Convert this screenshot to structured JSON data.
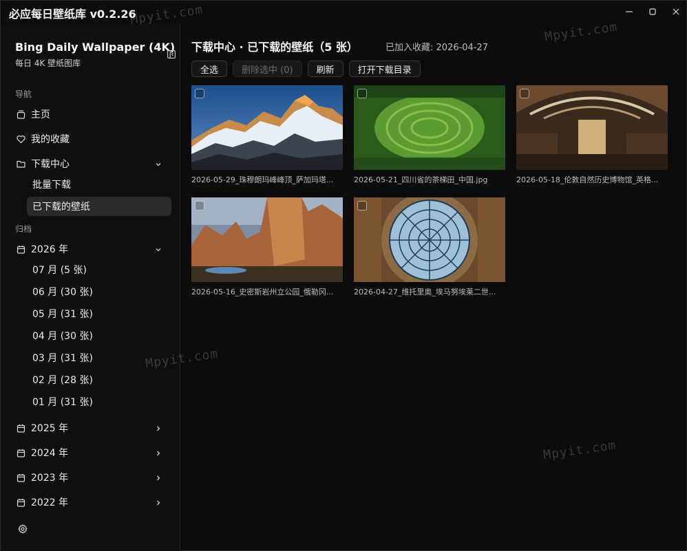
{
  "window": {
    "title": "必应每日壁纸库 v0.2.26"
  },
  "sidebar": {
    "brand_title": "Bing Daily Wallpaper (4K)",
    "brand_sub": "每日 4K 壁纸图库",
    "nav_label": "导航",
    "nav": [
      {
        "label": "主页",
        "icon": "home-icon"
      },
      {
        "label": "我的收藏",
        "icon": "heart-icon"
      },
      {
        "label": "下载中心",
        "icon": "folder-icon"
      }
    ],
    "download_sub": [
      {
        "label": "批量下载"
      },
      {
        "label": "已下载的壁纸",
        "active": true
      }
    ],
    "archive_label": "归档",
    "years": [
      {
        "label": "2026 年",
        "expanded": true
      },
      {
        "label": "2025 年"
      },
      {
        "label": "2024 年"
      },
      {
        "label": "2023 年"
      },
      {
        "label": "2022 年"
      }
    ],
    "months_2026": [
      {
        "label": "07 月 (5 张)"
      },
      {
        "label": "06 月 (30 张)"
      },
      {
        "label": "05 月 (31 张)"
      },
      {
        "label": "04 月 (30 张)"
      },
      {
        "label": "03 月 (31 张)"
      },
      {
        "label": "02 月 (28 张)"
      },
      {
        "label": "01 月 (31 张)"
      }
    ]
  },
  "main": {
    "title": "下载中心 · 已下载的壁纸（5 张）",
    "meta": "已加入收藏: 2026-04-27",
    "toolbar": {
      "select_all": "全选",
      "delete_selected": "删除选中 (0)",
      "refresh": "刷新",
      "open_folder": "打开下载目录"
    },
    "wallpapers": [
      {
        "caption": "2026-05-29_珠穆朗玛峰峰顶_萨加玛塔...",
        "scene": "mountain"
      },
      {
        "caption": "2026-05-21_四川省的茶梯田_中国.jpg",
        "scene": "tea"
      },
      {
        "caption": "2026-05-18_伦敦自然历史博物馆_英格...",
        "scene": "museum"
      },
      {
        "caption": "2026-05-16_史密斯岩州立公园_俄勒冈...",
        "scene": "rock"
      },
      {
        "caption": "2026-04-27_维托里奥_埃马努埃莱二世...",
        "scene": "dome"
      }
    ]
  },
  "watermark": "Mpyit.com",
  "colors": {
    "background": "#0c0c0c",
    "sidebar": "#101010",
    "active_item": "#2a2a2a"
  }
}
